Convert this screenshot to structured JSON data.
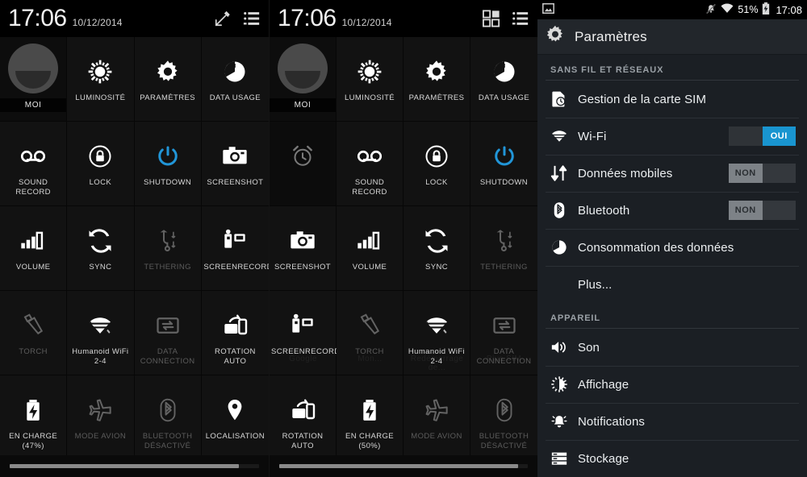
{
  "quick_settings_left": {
    "header": {
      "clock": "17:06",
      "date": "10/12/2014",
      "icons": [
        "edit-icon",
        "list-icon"
      ]
    },
    "tiles": [
      {
        "label": "MOI",
        "icon": "avatar-icon",
        "state": "avatar"
      },
      {
        "label": "LUMINOSITÉ",
        "icon": "brightness-icon",
        "state": "on"
      },
      {
        "label": "PARAMÈTRES",
        "icon": "gear-icon",
        "state": "on"
      },
      {
        "label": "DATA USAGE",
        "icon": "data-usage-icon",
        "state": "on"
      },
      {
        "label": "SOUND RECORD",
        "icon": "voicemail-icon",
        "state": "on"
      },
      {
        "label": "LOCK",
        "icon": "lock-icon",
        "state": "on"
      },
      {
        "label": "SHUTDOWN",
        "icon": "power-icon",
        "state": "accent"
      },
      {
        "label": "SCREENSHOT",
        "icon": "camera-icon",
        "state": "on"
      },
      {
        "label": "VOLUME",
        "icon": "volume-icon",
        "state": "on"
      },
      {
        "label": "SYNC",
        "icon": "sync-icon",
        "state": "on"
      },
      {
        "label": "TETHERING",
        "icon": "usb-tethering-icon",
        "state": "dim"
      },
      {
        "label": "SCREENRECORD",
        "icon": "camcorder-icon",
        "state": "on"
      },
      {
        "label": "TORCH",
        "icon": "flashlight-icon",
        "state": "dim"
      },
      {
        "label": "Humanoid WiFi 2-4",
        "icon": "wifi-icon",
        "state": "on"
      },
      {
        "label": "DATA CONNECTION",
        "icon": "data-connection-icon",
        "state": "dim"
      },
      {
        "label": "ROTATION AUTO",
        "icon": "rotation-icon",
        "state": "on"
      },
      {
        "label": "EN CHARGE (47%)",
        "icon": "battery-charging-icon",
        "state": "on"
      },
      {
        "label": "MODE AVION",
        "icon": "airplane-icon",
        "state": "dim"
      },
      {
        "label": "BLUETOOTH DÉSACTIVÉ",
        "icon": "bluetooth-icon",
        "state": "dim"
      },
      {
        "label": "LOCALISATION",
        "icon": "location-pin-icon",
        "state": "on"
      }
    ],
    "scrollbar": {
      "thumb_percent": 92
    }
  },
  "quick_settings_middle": {
    "header": {
      "clock": "17:06",
      "date": "10/12/2014",
      "icons": [
        "grid-icon",
        "list-icon"
      ]
    },
    "tiles": [
      {
        "label": "MOI",
        "icon": "avatar-icon",
        "state": "avatar"
      },
      {
        "label": "LUMINOSITÉ",
        "icon": "brightness-icon",
        "state": "on"
      },
      {
        "label": "PARAMÈTRES",
        "icon": "gear-icon",
        "state": "on"
      },
      {
        "label": "DATA USAGE",
        "icon": "data-usage-icon",
        "state": "on"
      },
      {
        "label": "",
        "icon": "alarm-clock-icon",
        "state": "empty"
      },
      {
        "label": "SOUND RECORD",
        "icon": "voicemail-icon",
        "state": "on"
      },
      {
        "label": "LOCK",
        "icon": "lock-icon",
        "state": "on"
      },
      {
        "label": "SHUTDOWN",
        "icon": "power-icon",
        "state": "accent"
      },
      {
        "label": "SCREENSHOT",
        "icon": "camera-icon",
        "state": "on"
      },
      {
        "label": "VOLUME",
        "icon": "volume-icon",
        "state": "on"
      },
      {
        "label": "SYNC",
        "icon": "sync-icon",
        "state": "on"
      },
      {
        "label": "TETHERING",
        "icon": "usb-tethering-icon",
        "state": "dim"
      },
      {
        "label": "SCREENRECORD",
        "icon": "camcorder-icon",
        "state": "on"
      },
      {
        "label": "TORCH",
        "icon": "flashlight-icon",
        "state": "dim"
      },
      {
        "label": "Humanoid WiFi 2-4",
        "icon": "wifi-icon",
        "state": "on"
      },
      {
        "label": "DATA CONNECTION",
        "icon": "data-connection-icon",
        "state": "dim"
      },
      {
        "label": "ROTATION AUTO",
        "icon": "rotation-icon",
        "state": "on"
      },
      {
        "label": "EN CHARGE (50%)",
        "icon": "battery-charging-icon",
        "state": "on"
      },
      {
        "label": "MODE AVION",
        "icon": "airplane-icon",
        "state": "dim"
      },
      {
        "label": "BLUETOOTH DÉSACTIVÉ",
        "icon": "bluetooth-icon",
        "state": "dim"
      }
    ],
    "ghost_labels": [
      "Google",
      "Mon...",
      "Redémarrage de...",
      "Plus SIM"
    ],
    "scrollbar": {
      "thumb_percent": 96
    }
  },
  "settings": {
    "status_bar": {
      "left_icons": [
        "image-icon"
      ],
      "right_icons": [
        "mute-icon",
        "wifi-icon",
        "battery-charging-icon"
      ],
      "battery_percent": "51%",
      "clock": "17:08"
    },
    "title": "Paramètres",
    "title_icon": "gear-icon",
    "sections": [
      {
        "header": "SANS FIL ET RÉSEAUX",
        "rows": [
          {
            "label": "Gestion de la carte SIM",
            "icon": "sim-card-icon",
            "toggle": null
          },
          {
            "label": "Wi-Fi",
            "icon": "wifi-icon",
            "toggle": {
              "state": "on",
              "label": "OUI"
            }
          },
          {
            "label": "Données mobiles",
            "icon": "mobile-data-icon",
            "toggle": {
              "state": "off",
              "label": "NON"
            }
          },
          {
            "label": "Bluetooth",
            "icon": "bluetooth-icon",
            "toggle": {
              "state": "off",
              "label": "NON"
            }
          },
          {
            "label": "Consommation des données",
            "icon": "data-usage-icon",
            "toggle": null
          },
          {
            "label": "Plus...",
            "icon": null,
            "toggle": null
          }
        ]
      },
      {
        "header": "APPAREIL",
        "rows": [
          {
            "label": "Son",
            "icon": "sound-icon",
            "toggle": null
          },
          {
            "label": "Affichage",
            "icon": "display-icon",
            "toggle": null
          },
          {
            "label": "Notifications",
            "icon": "notifications-icon",
            "toggle": null
          },
          {
            "label": "Stockage",
            "icon": "storage-icon",
            "toggle": null
          }
        ]
      }
    ]
  },
  "colors": {
    "accent_blue": "#1995d0",
    "tile_bg": "#121212",
    "settings_bg": "#1b1f24",
    "toggle_off": "#7d8287"
  }
}
